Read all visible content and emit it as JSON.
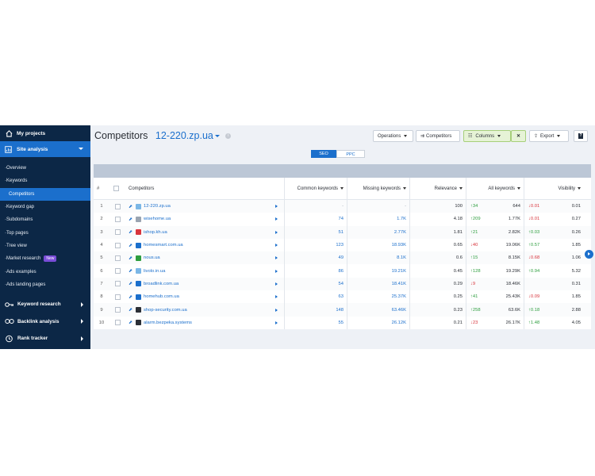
{
  "sidebar": {
    "my_projects": "My projects",
    "site_analysis": "Site analysis",
    "items": [
      {
        "label": "Overview"
      },
      {
        "label": "Keywords"
      },
      {
        "label": "Competitors"
      },
      {
        "label": "Keyword gap"
      },
      {
        "label": "Subdomains"
      },
      {
        "label": "Top pages"
      },
      {
        "label": "Tree view"
      },
      {
        "label": "Market research",
        "badge": "New"
      },
      {
        "label": "Ads examples"
      },
      {
        "label": "Ads landing pages"
      }
    ],
    "sections": [
      {
        "label": "Keyword research"
      },
      {
        "label": "Backlink analysis"
      },
      {
        "label": "Rank tracker"
      }
    ]
  },
  "header": {
    "title": "Competitors",
    "domain": "12-220.zp.ua",
    "operations": "Operations",
    "competitors": "Competitors",
    "columns": "Columns",
    "export": "Export",
    "help": "?"
  },
  "toggle": {
    "seo": "SEO",
    "ppc": "PPC"
  },
  "table": {
    "headers": {
      "num": "#",
      "competitors": "Competitors",
      "common": "Common keywords",
      "missing": "Missing keywords",
      "relevance": "Relevance",
      "all": "All keywords",
      "visibility": "Visibility"
    },
    "rows": [
      {
        "n": "1",
        "domain": "12-220.zp.ua",
        "common": "-",
        "missing": "-",
        "rel": "100",
        "all_delta": "↑34",
        "all_dir": "up",
        "all": "644",
        "vis_delta": "↓0.01",
        "vis_dir": "down",
        "vis": "0.01",
        "fav": "#7bb7e6"
      },
      {
        "n": "2",
        "domain": "wisehome.ua",
        "common": "74",
        "missing": "1.7K",
        "rel": "4.18",
        "all_delta": "↑209",
        "all_dir": "up",
        "all": "1.77K",
        "vis_delta": "↓0.01",
        "vis_dir": "down",
        "vis": "0.27",
        "fav": "#9aa4b1"
      },
      {
        "n": "3",
        "domain": "ishop.kh.ua",
        "common": "51",
        "missing": "2.77K",
        "rel": "1.81",
        "all_delta": "↑21",
        "all_dir": "up",
        "all": "2.82K",
        "vis_delta": "↑0.03",
        "vis_dir": "up",
        "vis": "0.26",
        "fav": "#d8343c"
      },
      {
        "n": "4",
        "domain": "homesmart.com.ua",
        "common": "123",
        "missing": "18.93K",
        "rel": "0.65",
        "all_delta": "↓40",
        "all_dir": "down",
        "all": "19.06K",
        "vis_delta": "↑0.57",
        "vis_dir": "up",
        "vis": "1.85",
        "fav": "#1b6fcc"
      },
      {
        "n": "5",
        "domain": "nous.ua",
        "common": "49",
        "missing": "8.1K",
        "rel": "0.6",
        "all_delta": "↑15",
        "all_dir": "up",
        "all": "8.15K",
        "vis_delta": "↓0.68",
        "vis_dir": "down",
        "vis": "1.06",
        "fav": "#2e9e3f"
      },
      {
        "n": "6",
        "domain": "livolo.in.ua",
        "common": "86",
        "missing": "19.21K",
        "rel": "0.45",
        "all_delta": "↑128",
        "all_dir": "up",
        "all": "19.29K",
        "vis_delta": "↑0.94",
        "vis_dir": "up",
        "vis": "5.32",
        "fav": "#7bb7e6"
      },
      {
        "n": "7",
        "domain": "broadlink.com.ua",
        "common": "54",
        "missing": "18.41K",
        "rel": "0.29",
        "all_delta": "↓9",
        "all_dir": "down",
        "all": "18.46K",
        "vis_delta": "",
        "vis_dir": "up",
        "vis": "0.31",
        "fav": "#1b6fcc"
      },
      {
        "n": "8",
        "domain": "homehub.com.ua",
        "common": "63",
        "missing": "25.37K",
        "rel": "0.25",
        "all_delta": "↑41",
        "all_dir": "up",
        "all": "25.43K",
        "vis_delta": "↓0.09",
        "vis_dir": "down",
        "vis": "1.85",
        "fav": "#1b6fcc"
      },
      {
        "n": "9",
        "domain": "shop-security.com.ua",
        "common": "148",
        "missing": "63.46K",
        "rel": "0.23",
        "all_delta": "↑258",
        "all_dir": "up",
        "all": "63.6K",
        "vis_delta": "↑0.18",
        "vis_dir": "up",
        "vis": "2.88",
        "fav": "#2b2f36"
      },
      {
        "n": "10",
        "domain": "alarm.bezpeka.systems",
        "common": "55",
        "missing": "26.12K",
        "rel": "0.21",
        "all_delta": "↓23",
        "all_dir": "down",
        "all": "26.17K",
        "vis_delta": "↑1.48",
        "vis_dir": "up",
        "vis": "4.05",
        "fav": "#2b2f36"
      }
    ]
  }
}
